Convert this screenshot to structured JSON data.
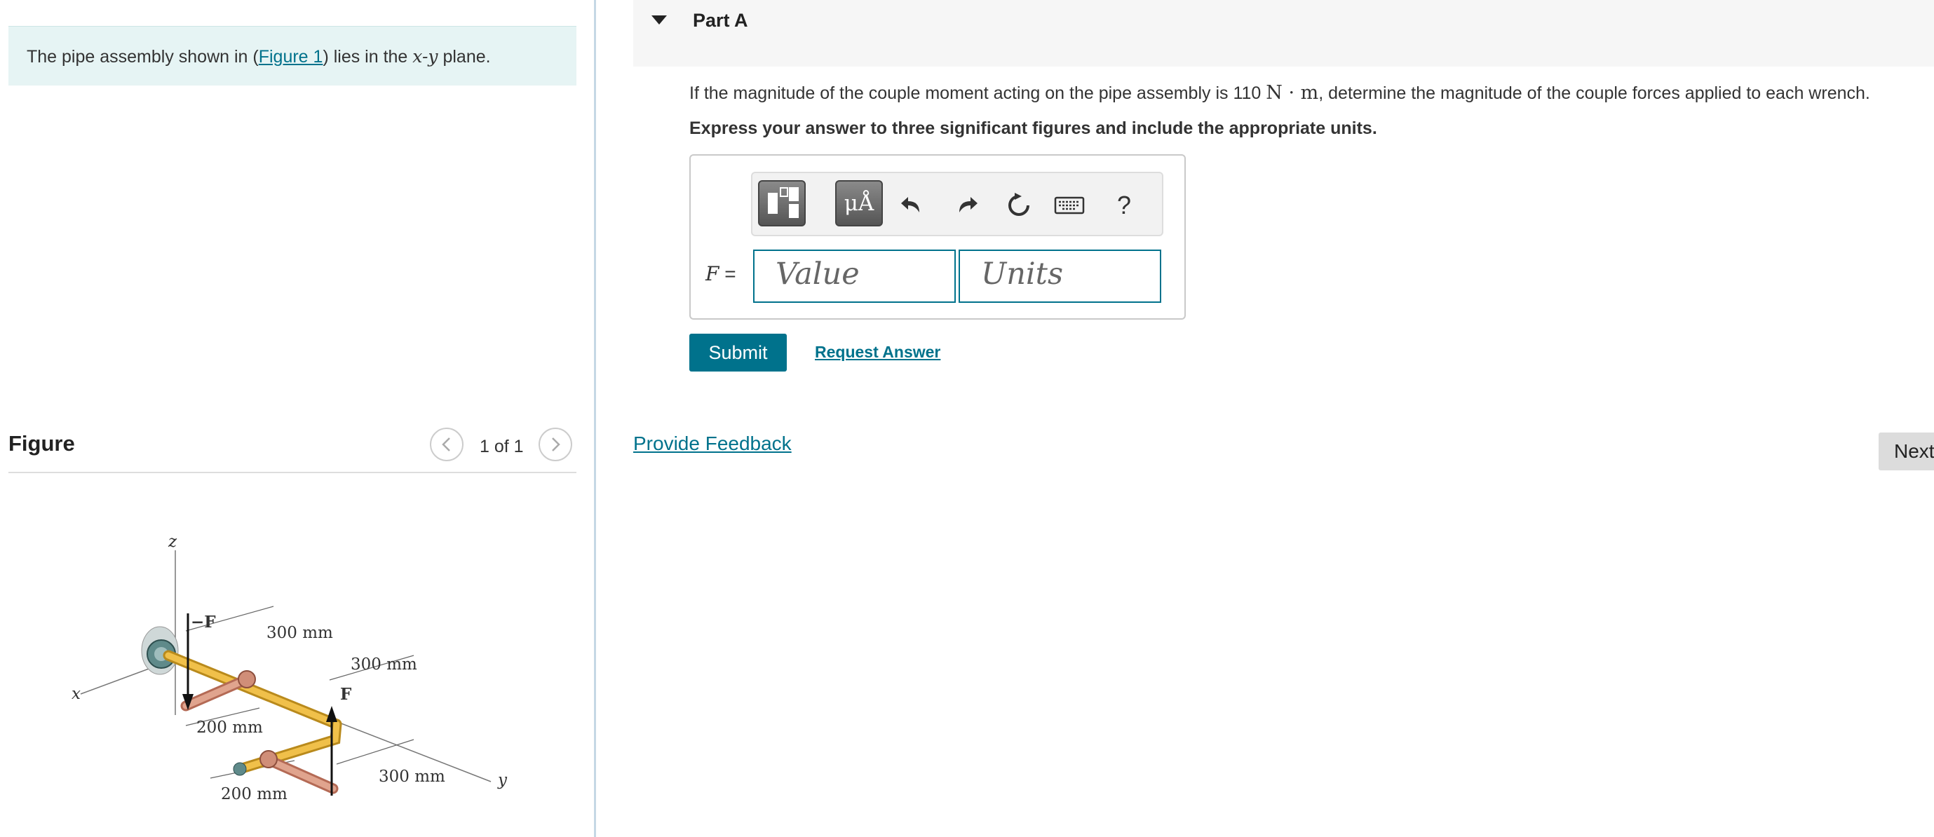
{
  "problem": {
    "text_before": "The pipe assembly shown in (",
    "figure_link": "Figure 1",
    "text_after": ") lies in the ",
    "plane_math": "x-y",
    "text_end": " plane."
  },
  "figure": {
    "title": "Figure",
    "pager": "1 of 1",
    "labels": {
      "z": "z",
      "x": "x",
      "y": "y",
      "neg_force": "−F",
      "force": "F",
      "dim_300_a": "300 mm",
      "dim_300_b": "300 mm",
      "dim_300_c": "300 mm",
      "dim_200_a": "200 mm",
      "dim_200_b": "200 mm"
    }
  },
  "part": {
    "title": "Part A",
    "question_before": "If the magnitude of the couple moment acting on the pipe assembly is 110 ",
    "question_unit": "N · m",
    "question_after": ", determine the magnitude of the couple forces applied to each wrench.",
    "instruction": "Express your answer to three significant figures and include the appropriate units."
  },
  "answer": {
    "variable": "F",
    "equals": "=",
    "value_placeholder": "Value",
    "units_placeholder": "Units",
    "toolbar": {
      "symbols_label": "μÅ",
      "help_label": "?"
    }
  },
  "actions": {
    "submit": "Submit",
    "request_answer": "Request Answer",
    "feedback": "Provide Feedback",
    "next": "Next"
  }
}
